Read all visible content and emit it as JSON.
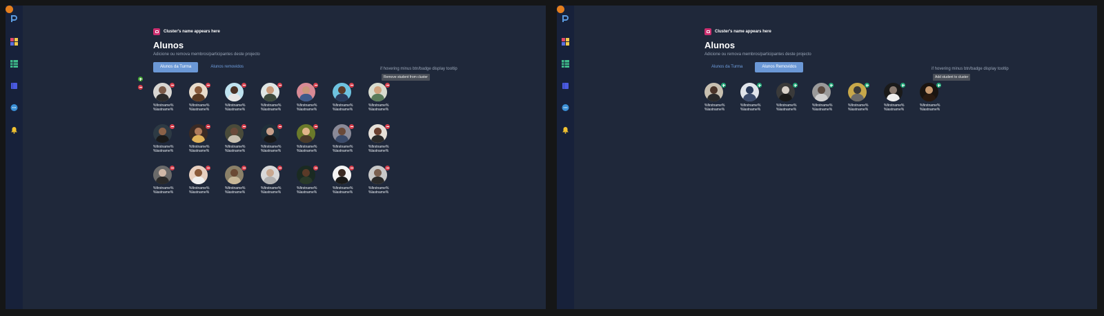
{
  "left": {
    "cluster_name": "Cluster's name appears here",
    "title": "Alunos",
    "subtitle": "Adicione ou remova membros/participantes deste projecto",
    "tabs": [
      {
        "label": "Alunos da Turma",
        "active": true
      },
      {
        "label": "Alunos removidos",
        "active": false
      }
    ],
    "note": "if hovering minus btn/badge display tooltip",
    "tooltip": "Remove student from cluster",
    "badge_type": "minus",
    "students": [
      {
        "first": "%firstname%",
        "last": "%lastname%",
        "bg": "#d8d6d2",
        "skin": "#7a5a48",
        "shirt": "#2b2b2b"
      },
      {
        "first": "%firstname%",
        "last": "%lastname%",
        "bg": "#e9dccb",
        "skin": "#8a5a3a",
        "shirt": "#5b3a22"
      },
      {
        "first": "%firstname%",
        "last": "%lastname%",
        "bg": "#bfe3f0",
        "skin": "#4a3226",
        "shirt": "#e6e6e6"
      },
      {
        "first": "%firstname%",
        "last": "%lastname%",
        "bg": "#dfe6e4",
        "skin": "#c89a7a",
        "shirt": "#3c4a3c"
      },
      {
        "first": "%firstname%",
        "last": "%lastname%",
        "bg": "#d88a95",
        "skin": "#c8977a",
        "shirt": "#3d5a8a"
      },
      {
        "first": "%firstname%",
        "last": "%lastname%",
        "bg": "#6ec3e0",
        "skin": "#5a3b2a",
        "shirt": "#2a3a5a"
      },
      {
        "first": "%firstname%",
        "last": "%lastname%",
        "bg": "#d9dccf",
        "skin": "#d0a27e",
        "shirt": "#5a7a5a"
      },
      {
        "first": "%firstname%",
        "last": "%lastname%",
        "bg": "#2d3a44",
        "skin": "#8a6148",
        "shirt": "#1a1a1a"
      },
      {
        "first": "%firstname%",
        "last": "%lastname%",
        "bg": "#3a2a24",
        "skin": "#b07a5a",
        "shirt": "#e0b25a"
      },
      {
        "first": "%firstname%",
        "last": "%lastname%",
        "bg": "#4a4b3a",
        "skin": "#6a4a3a",
        "shirt": "#c8c0b0"
      },
      {
        "first": "%firstname%",
        "last": "%lastname%",
        "bg": "#20303a",
        "skin": "#c8a08a",
        "shirt": "#1a1a1a"
      },
      {
        "first": "%firstname%",
        "last": "%lastname%",
        "bg": "#6a7a2a",
        "skin": "#e0b48a",
        "shirt": "#4a3a2a"
      },
      {
        "first": "%firstname%",
        "last": "%lastname%",
        "bg": "#8a8a98",
        "skin": "#6a4a3a",
        "shirt": "#3a4a6a"
      },
      {
        "first": "%firstname%",
        "last": "%lastname%",
        "bg": "#e6e0d8",
        "skin": "#6a4030",
        "shirt": "#2a2a2a"
      },
      {
        "first": "%firstname%",
        "last": "%lastname%",
        "bg": "#6a6a6a",
        "skin": "#d0b8a8",
        "shirt": "#2a2a2a"
      },
      {
        "first": "%firstname%",
        "last": "%lastname%",
        "bg": "#e8d0c0",
        "skin": "#8a5a3a",
        "shirt": "#f0f0f0"
      },
      {
        "first": "%firstname%",
        "last": "%lastname%",
        "bg": "#8a8068",
        "skin": "#6a4a34",
        "shirt": "#c8b898"
      },
      {
        "first": "%firstname%",
        "last": "%lastname%",
        "bg": "#d8d8d8",
        "skin": "#c8a890",
        "shirt": "#b0b0b0"
      },
      {
        "first": "%firstname%",
        "last": "%lastname%",
        "bg": "#1a2a22",
        "skin": "#5a3a28",
        "shirt": "#2a3a2a"
      },
      {
        "first": "%firstname%",
        "last": "%lastname%",
        "bg": "#f4f4f4",
        "skin": "#3a2a22",
        "shirt": "#1a1a1a"
      },
      {
        "first": "%firstname%",
        "last": "%lastname%",
        "bg": "#c8c8c8",
        "skin": "#7a6050",
        "shirt": "#2a2a2a"
      }
    ]
  },
  "right": {
    "cluster_name": "Cluster's name appears here",
    "title": "Alunos",
    "subtitle": "Adicione ou remova membros/participantes deste projecto",
    "tabs": [
      {
        "label": "Alunos da Turma",
        "active": false
      },
      {
        "label": "Alunos Removidos",
        "active": true
      }
    ],
    "note": "if hovering minus btn/badge display tooltip",
    "tooltip": "Add student to cluster",
    "badge_type": "plus",
    "students": [
      {
        "first": "%firstname%",
        "last": "%lastname%",
        "bg": "#c8c0b0",
        "skin": "#4a3428",
        "shirt": "#2a2a2a"
      },
      {
        "first": "%firstname%",
        "last": "%lastname%",
        "bg": "#e0e4ea",
        "skin": "#2a3a5a",
        "shirt": "#3a4a6a"
      },
      {
        "first": "%firstname%",
        "last": "%lastname%",
        "bg": "#3a3a3a",
        "skin": "#d8d0c8",
        "shirt": "#1a1a1a"
      },
      {
        "first": "%firstname%",
        "last": "%lastname%",
        "bg": "#9a9a9a",
        "skin": "#5a4a40",
        "shirt": "#d0d0d0"
      },
      {
        "first": "%firstname%",
        "last": "%lastname%",
        "bg": "#c8a84a",
        "skin": "#3a3a3a",
        "shirt": "#6a6a6a"
      },
      {
        "first": "%firstname%",
        "last": "%lastname%",
        "bg": "#1a1a1a",
        "skin": "#8a7a70",
        "shirt": "#f0f0f0"
      },
      {
        "first": "%firstname%",
        "last": "%lastname%",
        "bg": "#1a1410",
        "skin": "#c89a70",
        "shirt": "#2a1a10"
      }
    ]
  },
  "colors": {
    "frame_bg": "#1f283a",
    "sidebar_bg": "#17213a",
    "accent": "#6b98d6",
    "remove_badge": "#d8414f",
    "add_badge": "#23a978",
    "cluster_badge": "#cc2f6f"
  },
  "icons": [
    "logo-icon",
    "apps-icon",
    "table-icon",
    "book-icon",
    "chat-icon",
    "bell-icon",
    "user-avatar"
  ]
}
